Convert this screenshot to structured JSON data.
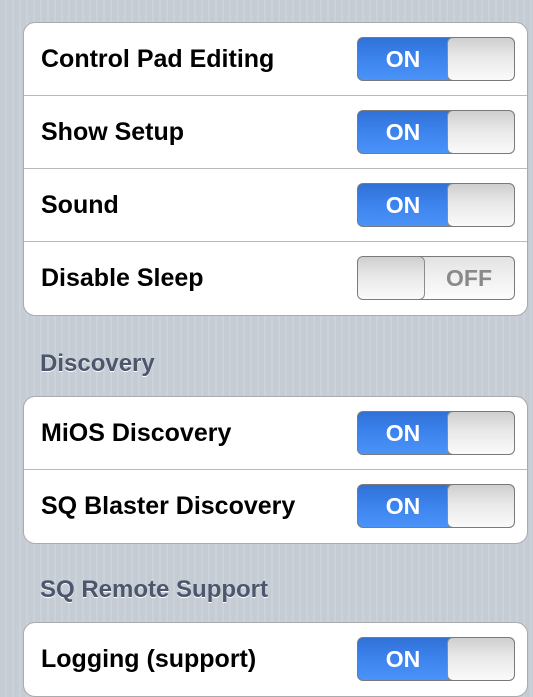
{
  "groups": [
    {
      "header": "",
      "rows": [
        {
          "label": "Control Pad Editing",
          "state": "ON"
        },
        {
          "label": "Show Setup",
          "state": "ON"
        },
        {
          "label": "Sound",
          "state": "ON"
        },
        {
          "label": "Disable Sleep",
          "state": "OFF"
        }
      ]
    },
    {
      "header": "Discovery",
      "rows": [
        {
          "label": "MiOS Discovery",
          "state": "ON"
        },
        {
          "label": "SQ Blaster Discovery",
          "state": "ON"
        }
      ]
    },
    {
      "header": "SQ Remote Support",
      "rows": [
        {
          "label": "Logging (support)",
          "state": "ON"
        }
      ]
    }
  ],
  "colors": {
    "switch_on": "#3c82ec",
    "background": "#c5ccd4",
    "section_header": "#4c566c"
  }
}
